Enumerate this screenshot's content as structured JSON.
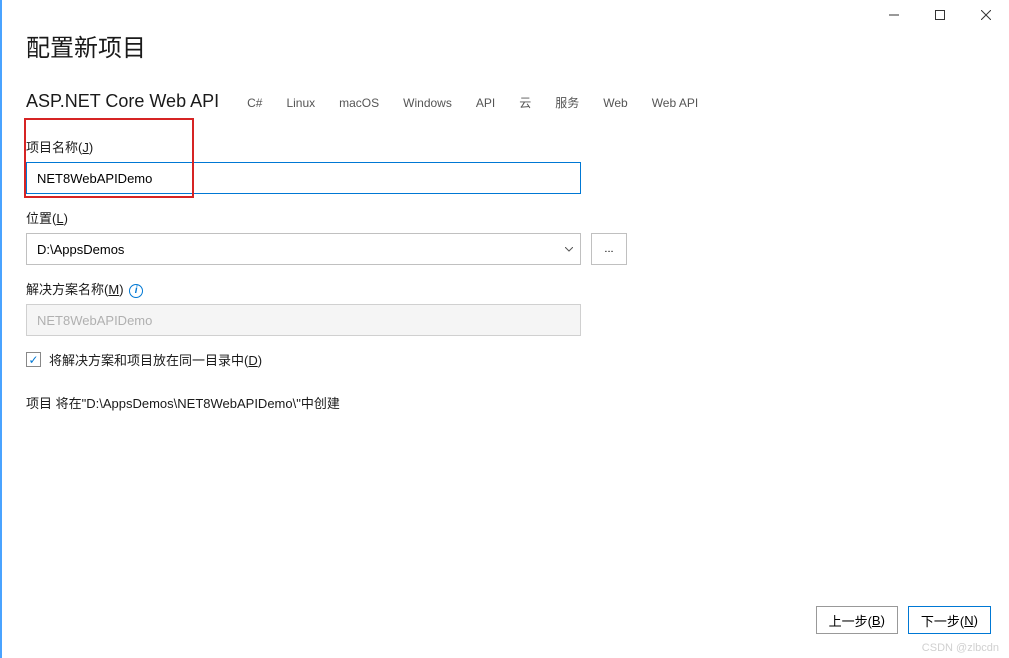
{
  "window": {
    "title": "配置新项目",
    "subtitle": "ASP.NET Core Web API",
    "tags": [
      "C#",
      "Linux",
      "macOS",
      "Windows",
      "API",
      "云",
      "服务",
      "Web",
      "Web API"
    ]
  },
  "form": {
    "projectName": {
      "label_prefix": "项目名称(",
      "label_underline": "J",
      "label_suffix": ")",
      "value": "NET8WebAPIDemo"
    },
    "location": {
      "label_prefix": "位置(",
      "label_underline": "L",
      "label_suffix": ")",
      "value": "D:\\AppsDemos",
      "browse_label": "..."
    },
    "solutionName": {
      "label_prefix": "解决方案名称(",
      "label_underline": "M",
      "label_suffix": ")",
      "value": "NET8WebAPIDemo",
      "info_icon": "i"
    },
    "sameDir": {
      "checked": true,
      "label_prefix": "将解决方案和项目放在同一目录中(",
      "label_underline": "D",
      "label_suffix": ")",
      "checkmark": "✓"
    },
    "pathInfo": "项目 将在\"D:\\AppsDemos\\NET8WebAPIDemo\\\"中创建"
  },
  "footer": {
    "back_prefix": "上一步(",
    "back_underline": "B",
    "back_suffix": ")",
    "next_prefix": "下一步(",
    "next_underline": "N",
    "next_suffix": ")"
  },
  "watermark": "CSDN @zlbcdn"
}
